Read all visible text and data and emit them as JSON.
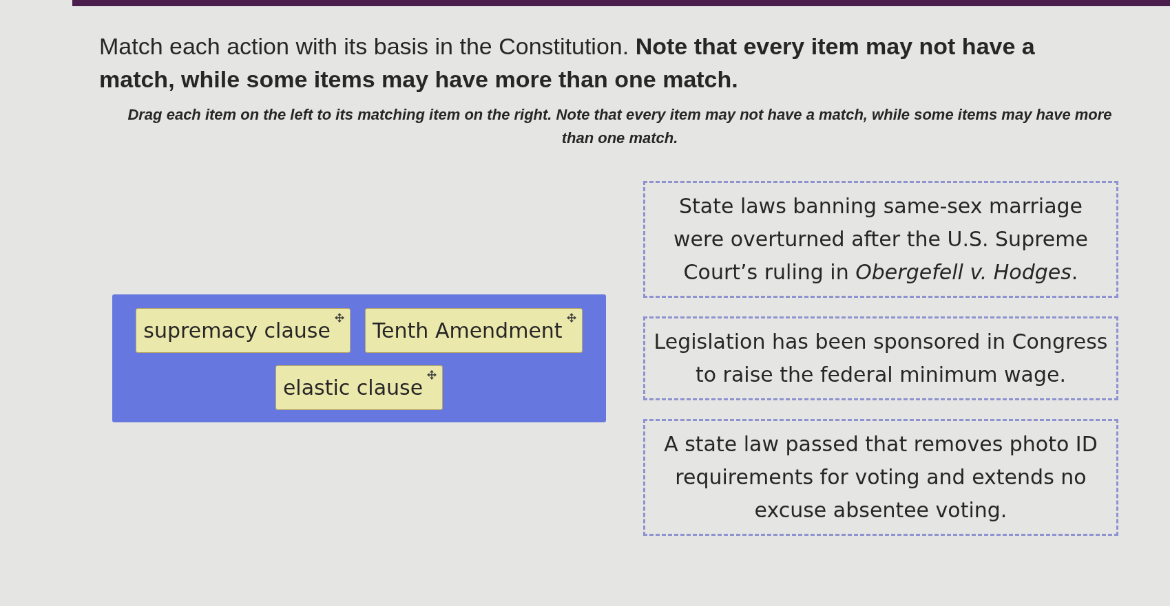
{
  "question": {
    "prompt": "Match each action with its basis in the Constitution. **Note that every item may not have a match, while some items may have more than one match.**",
    "instructions": "Drag each item on the left to its matching item on the right. Note that every item may not have a match, while some items may have more than one match."
  },
  "drag_items": [
    {
      "label": "supremacy clause"
    },
    {
      "label": "Tenth Amendment"
    },
    {
      "label": "elastic clause"
    }
  ],
  "targets": [
    {
      "text": "State laws banning same-sex marriage were overturned after the U.S. Supreme Court’s ruling in *Obergefell v. Hodges*."
    },
    {
      "text": "Legislation has been sponsored in Congress to raise the federal minimum wage."
    },
    {
      "text": "A state law passed that removes photo ID requirements for voting and extends no excuse absentee voting."
    }
  ]
}
